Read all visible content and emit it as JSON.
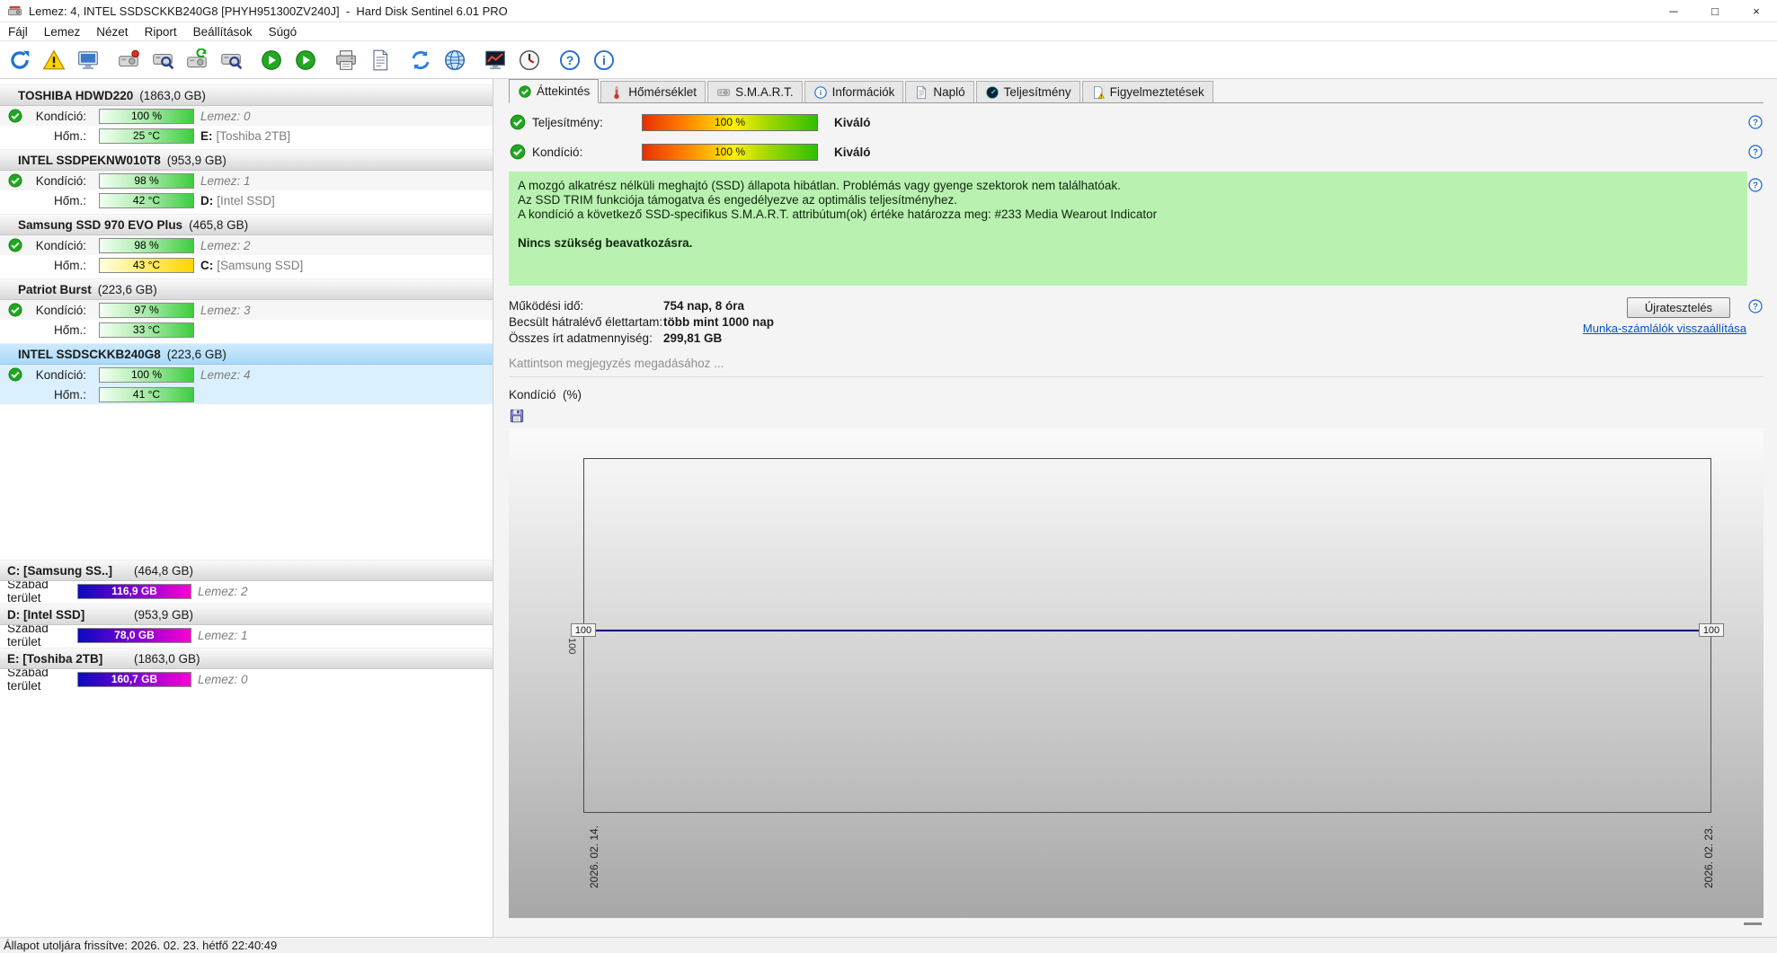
{
  "window": {
    "title": "Lemez: 4, INTEL SSDSCKKB240G8 [PHYH951300ZV240J]  -  Hard Disk Sentinel 6.01 PRO",
    "controls": {
      "minimize": "─",
      "maximize": "□",
      "close": "×"
    }
  },
  "menu": {
    "items": [
      "Fájl",
      "Lemez",
      "Nézet",
      "Riport",
      "Beállítások",
      "Súgó"
    ]
  },
  "toolbar": {
    "icons": [
      "refresh-icon",
      "warning-icon",
      "monitor-icon",
      "disk-remove-icon",
      "disk-search-icon",
      "disk-refresh-icon",
      "disk-scan-icon",
      "run-test-icon",
      "quick-test-icon",
      "printer-icon",
      "report-icon",
      "sync-icon",
      "web-icon",
      "performance-monitor-icon",
      "clock-icon",
      "help-icon",
      "info-icon"
    ]
  },
  "labels": {
    "condition": "Kondíció:",
    "temperature": "Hőm.:",
    "free_space": "Szabad terület"
  },
  "disks": [
    {
      "name": "TOSHIBA HDWD220",
      "size": "(1863,0 GB)",
      "status": "ok",
      "cond_value": "100 %",
      "disk_no": "Lemez: 0",
      "temp_value": "25 °C",
      "drive": "E:",
      "drive_name": "[Toshiba 2TB]",
      "selected": false
    },
    {
      "name": "INTEL SSDPEKNW010T8",
      "size": "(953,9 GB)",
      "status": "ok",
      "cond_value": "98 %",
      "disk_no": "Lemez: 1",
      "temp_value": "42 °C",
      "drive": "D:",
      "drive_name": "[Intel SSD]",
      "selected": false
    },
    {
      "name": "Samsung SSD 970 EVO Plus",
      "size": "(465,8 GB)",
      "status": "ok",
      "cond_value": "98 %",
      "disk_no": "Lemez: 2",
      "temp_value": "43 °C",
      "drive": "C:",
      "drive_name": "[Samsung SSD]",
      "selected": false
    },
    {
      "name": "Patriot Burst",
      "size": "(223,6 GB)",
      "status": "ok",
      "cond_value": "97 %",
      "disk_no": "Lemez: 3",
      "temp_value": "33 °C",
      "drive": "",
      "drive_name": "",
      "selected": false
    },
    {
      "name": "INTEL SSDSCKKB240G8",
      "size": "(223,6 GB)",
      "status": "ok",
      "cond_value": "100 %",
      "disk_no": "Lemez: 4",
      "temp_value": "41 °C",
      "drive": "",
      "drive_name": "",
      "selected": true
    }
  ],
  "partitions": [
    {
      "name": "C: [Samsung SS..]",
      "size": "(464,8 GB)",
      "free_value": "116,9 GB",
      "disk_no": "Lemez: 2"
    },
    {
      "name": "D: [Intel SSD]",
      "size": "(953,9 GB)",
      "free_value": "78,0 GB",
      "disk_no": "Lemez: 1"
    },
    {
      "name": "E: [Toshiba 2TB]",
      "size": "(1863,0 GB)",
      "free_value": "160,7 GB",
      "disk_no": "Lemez: 0"
    }
  ],
  "tabs": {
    "items": [
      {
        "label": "Áttekintés",
        "icon": "check-icon",
        "active": true
      },
      {
        "label": "Hőmérséklet",
        "icon": "thermometer-icon",
        "active": false
      },
      {
        "label": "S.M.A.R.T.",
        "icon": "disk-icon",
        "active": false
      },
      {
        "label": "Információk",
        "icon": "info-icon",
        "active": false
      },
      {
        "label": "Napló",
        "icon": "log-icon",
        "active": false
      },
      {
        "label": "Teljesítmény",
        "icon": "performance-icon",
        "active": false
      },
      {
        "label": "Figyelmeztetések",
        "icon": "warnings-icon",
        "active": false
      }
    ]
  },
  "overview": {
    "perf_label": "Teljesítmény:",
    "perf_value": "100 %",
    "perf_rating": "Kiváló",
    "cond_label": "Kondíció:",
    "cond_value": "100 %",
    "cond_rating": "Kiváló",
    "message_lines": [
      "A mozgó alkatrész nélküli meghajtó (SSD) állapota hibátlan. Problémás vagy gyenge szektorok nem találhatóak.",
      "Az SSD TRIM funkciója támogatva és engedélyezve az optimális teljesítményhez.",
      "A kondíció a következő SSD-specifikus S.M.A.R.T. attribútum(ok) értéke határozza meg:  #233 Media Wearout Indicator"
    ],
    "message_action": "Nincs szükség beavatkozásra.",
    "stats": [
      {
        "label": "Működési idő:",
        "value": "754 nap, 8 óra"
      },
      {
        "label": "Becsült hátralévő élettartam:",
        "value": "több mint 1000 nap"
      },
      {
        "label": "Összes írt adatmennyiség:",
        "value": "299,81 GB"
      }
    ],
    "retest_button": "Újratesztelés",
    "reset_link": "Munka-számlálók visszaállítása",
    "comment_hint": "Kattintson megjegyzés megadásához ..."
  },
  "chart_data": {
    "type": "line",
    "title": "Kondíció  (%)",
    "x": [
      "2026. 02. 14.",
      "2026. 02. 23."
    ],
    "series": [
      {
        "name": "Kondíció",
        "values": [
          100,
          100
        ]
      }
    ],
    "ylim": [
      0,
      200
    ],
    "y_axis_label": "100",
    "point_labels": [
      "100",
      "100"
    ],
    "grid": false,
    "legend": "none"
  },
  "statusbar": {
    "text": "Állapot utoljára frissítve: 2026. 02. 23. hétfő 22:40:49"
  }
}
